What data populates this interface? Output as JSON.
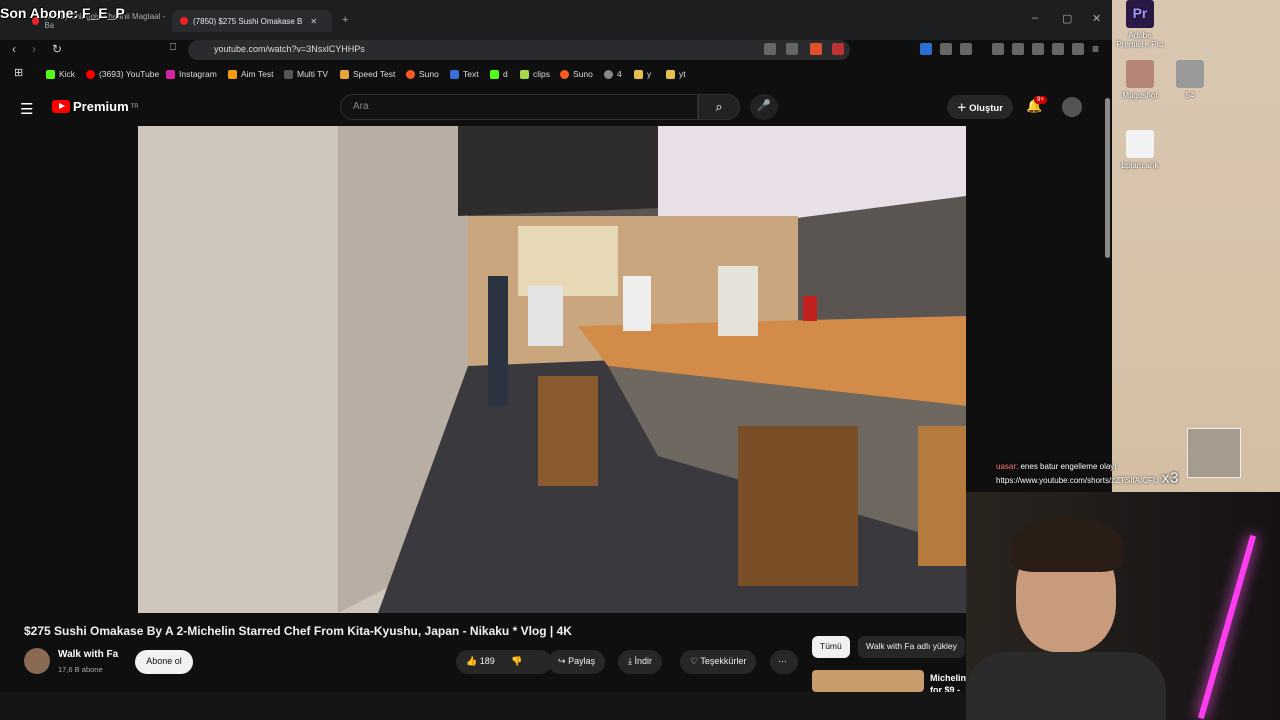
{
  "overlay": {
    "top_left": "Son Abone: F_E_P",
    "chat_user": "uasar:",
    "chat_msg": "enes batur engelleme olayı",
    "chat_link": "https://www.youtube.com/shorts/zZTSIIAICFU",
    "chat_counter": "x3"
  },
  "tabs": [
    {
      "label": "(7850) Chinggis Khaanii Magtaal - Ba"
    },
    {
      "label": "(7850) $275 Sushi Omakase B"
    }
  ],
  "address": {
    "url": "youtube.com/watch?v=3NsxlCYHHPs"
  },
  "bookmarks": [
    "Kick",
    "(3693) YouTube",
    "Instagram",
    "Aim Test",
    "Multi TV",
    "Speed Test",
    "Suno",
    "Text",
    "d",
    "clips",
    "Suno",
    "4",
    "y",
    "yt"
  ],
  "yt": {
    "logo": "Premium",
    "logo_sup": "TR",
    "search_placeholder": "Ara",
    "create": "Oluştur",
    "notif_badge": "9+"
  },
  "video": {
    "title": "$275 Sushi Omakase By A 2-Michelin Starred Chef From Kita-Kyushu, Japan - Nikaku * Vlog | 4K",
    "channel": "Walk with Fa",
    "subs": "17,6 B abone",
    "subscribe": "Abone ol",
    "likes": "189",
    "share": "Paylaş",
    "download": "İndir",
    "thanks": "Teşekkürler",
    "more": "⋯"
  },
  "chips": {
    "all": "Tümü",
    "uploader": "Walk with Fa adlı yükley"
  },
  "rec": {
    "title_line1": "Michelin",
    "title_line2": "for $9 -"
  },
  "desktop": [
    {
      "label": "Adobe Premiere Pro",
      "short": "Pr"
    },
    {
      "label": "Mugoshot"
    },
    {
      "label": "54"
    },
    {
      "label": "bplam.ahk"
    }
  ],
  "colors": {
    "yt_red": "#ff0000",
    "bg": "#0f0f0f",
    "neon": "#ff3cf0"
  }
}
